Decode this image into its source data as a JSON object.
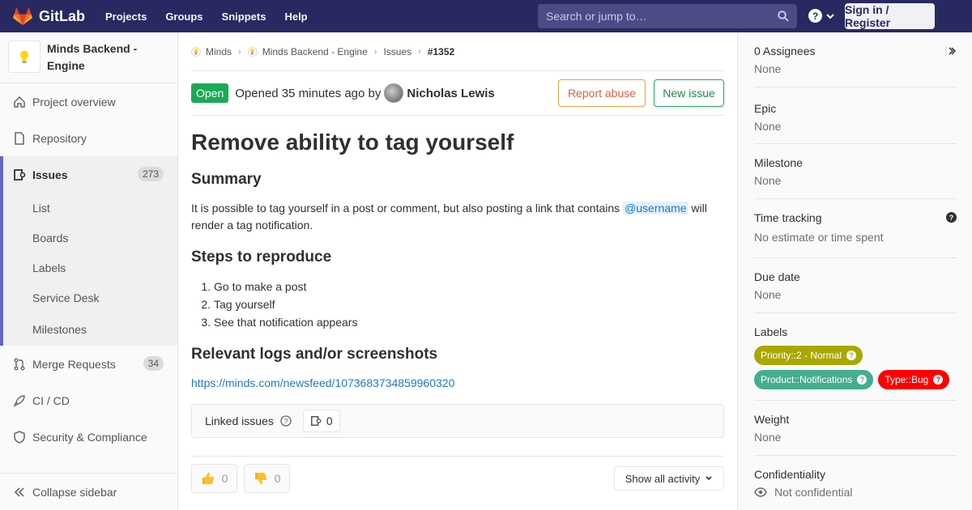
{
  "navbar": {
    "brand": "GitLab",
    "links": [
      "Projects",
      "Groups",
      "Snippets",
      "Help"
    ],
    "search_placeholder": "Search or jump to…",
    "signin": "Sign in / Register"
  },
  "sidebar": {
    "project_name": "Minds Backend - Engine",
    "items": [
      {
        "label": "Project overview",
        "icon": "home-icon"
      },
      {
        "label": "Repository",
        "icon": "doc-icon"
      },
      {
        "label": "Issues",
        "icon": "issues-icon",
        "count": "273"
      },
      {
        "label": "Merge Requests",
        "icon": "merge-icon",
        "count": "34"
      },
      {
        "label": "CI / CD",
        "icon": "rocket-icon"
      },
      {
        "label": "Security & Compliance",
        "icon": "shield-icon"
      }
    ],
    "issue_subitems": [
      "List",
      "Boards",
      "Labels",
      "Service Desk",
      "Milestones"
    ],
    "collapse": "Collapse sidebar"
  },
  "breadcrumbs": [
    "Minds",
    "Minds Backend - Engine",
    "Issues",
    "#1352"
  ],
  "issue": {
    "status": "Open",
    "opened_text": "Opened 35 minutes ago by",
    "author": "Nicholas Lewis",
    "report_abuse": "Report abuse",
    "new_issue": "New issue",
    "title": "Remove ability to tag yourself",
    "summary_heading": "Summary",
    "summary_before": "It is possible to tag yourself in a post or comment, but also posting a link that contains ",
    "mention": "@username",
    "summary_after": " will render a tag notification.",
    "steps_heading": "Steps to reproduce",
    "steps": [
      "Go to make a post",
      "Tag yourself",
      "See that notification appears"
    ],
    "logs_heading": "Relevant logs and/or screenshots",
    "log_link": "https://minds.com/newsfeed/1073683734859960320",
    "linked_issues": "Linked issues",
    "linked_count": "0",
    "thumbs_up": "0",
    "thumbs_down": "0",
    "activity_filter": "Show all activity"
  },
  "right_sidebar": {
    "assignees_title": "0 Assignees",
    "assignees_value": "None",
    "epic_title": "Epic",
    "epic_value": "None",
    "milestone_title": "Milestone",
    "milestone_value": "None",
    "time_title": "Time tracking",
    "time_value": "No estimate or time spent",
    "due_title": "Due date",
    "due_value": "None",
    "labels_title": "Labels",
    "labels": [
      {
        "text": "Priority::2 - Normal",
        "color": "#a8a800"
      },
      {
        "text": "Product::Notifications",
        "color": "#44ad8e"
      },
      {
        "text": "Type::Bug",
        "color": "#ff0000"
      }
    ],
    "weight_title": "Weight",
    "weight_value": "None",
    "confidentiality_title": "Confidentiality",
    "confidentiality_value": "Not confidential"
  }
}
